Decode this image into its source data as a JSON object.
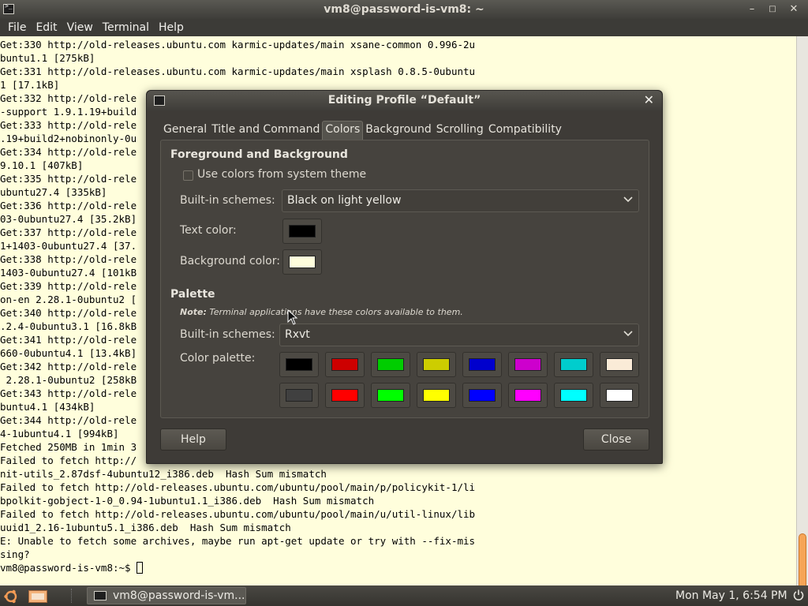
{
  "window": {
    "title": "vm8@password-is-vm8: ~"
  },
  "menu": [
    "File",
    "Edit",
    "View",
    "Terminal",
    "Help"
  ],
  "terminal": {
    "lines": [
      "Get:330 http://old-releases.ubuntu.com karmic-updates/main xsane-common 0.996-2u",
      "buntu1.1 [275kB]",
      "Get:331 http://old-releases.ubuntu.com karmic-updates/main xsplash 0.8.5-0ubuntu",
      "1 [17.1kB]",
      "Get:332 http://old-rele",
      "-support 1.9.1.19+build",
      "Get:333 http://old-rele",
      ".19+build2+nobinonly-0u",
      "Get:334 http://old-rele",
      "9.10.1 [407kB]",
      "Get:335 http://old-rele",
      "ubuntu27.4 [335kB]",
      "Get:336 http://old-rele",
      "03-0ubuntu27.4 [35.2kB]",
      "Get:337 http://old-rele",
      "1+1403-0ubuntu27.4 [37.",
      "Get:338 http://old-rele",
      "1403-0ubuntu27.4 [101kB",
      "Get:339 http://old-rele",
      "on-en 2.28.1-0ubuntu2 [",
      "Get:340 http://old-rele",
      ".2.4-0ubuntu3.1 [16.8kB",
      "Get:341 http://old-rele",
      "660-0ubuntu4.1 [13.4kB]",
      "Get:342 http://old-rele",
      " 2.28.1-0ubuntu2 [258kB",
      "Get:343 http://old-rele",
      "buntu4.1 [434kB]",
      "Get:344 http://old-rele",
      "4-1ubuntu4.1 [994kB]",
      "Fetched 250MB in 1min 3",
      "Failed to fetch http://",
      "nit-utils_2.87dsf-4ubuntu12_i386.deb  Hash Sum mismatch",
      "Failed to fetch http://old-releases.ubuntu.com/ubuntu/pool/main/p/policykit-1/li",
      "bpolkit-gobject-1-0_0.94-1ubuntu1.1_i386.deb  Hash Sum mismatch",
      "Failed to fetch http://old-releases.ubuntu.com/ubuntu/pool/main/u/util-linux/lib",
      "uuid1_2.16-1ubuntu5.1_i386.deb  Hash Sum mismatch",
      "E: Unable to fetch some archives, maybe run apt-get update or try with --fix-mis",
      "sing?"
    ],
    "prompt": "vm8@password-is-vm8:~$ "
  },
  "dialog": {
    "title": "Editing Profile “Default”",
    "tabs": [
      "General",
      "Title and Command",
      "Colors",
      "Background",
      "Scrolling",
      "Compatibility"
    ],
    "active_tab": "Colors",
    "fg_bg": {
      "heading": "Foreground and Background",
      "use_system_label": "Use colors from system theme",
      "use_system_checked": false,
      "schemes_label": "Built-in schemes:",
      "schemes_value": "Black on light yellow",
      "text_color_label": "Text color:",
      "text_color": "#000000",
      "bg_color_label": "Background color:",
      "bg_color": "#fffedc"
    },
    "palette": {
      "heading": "Palette",
      "note_bold": "Note:",
      "note_text": " Terminal applications have these colors available to them.",
      "schemes_label": "Built-in schemes:",
      "schemes_value": "Rxvt",
      "palette_label": "Color palette:",
      "row1": [
        "#000000",
        "#cd0000",
        "#00cd00",
        "#cdcd00",
        "#0000cd",
        "#cd00cd",
        "#00cdcd",
        "#faebd7"
      ],
      "row2": [
        "#404040",
        "#ff0000",
        "#00ff00",
        "#ffff00",
        "#0000ff",
        "#ff00ff",
        "#00ffff",
        "#ffffff"
      ]
    },
    "help_label": "Help",
    "close_label": "Close"
  },
  "taskbar": {
    "task_label": "vm8@password-is-vm...",
    "clock": "Mon May  1,  6:54 PM"
  },
  "colors": {
    "terminal_bg": "#fffedc",
    "accent": "#f6a557"
  }
}
